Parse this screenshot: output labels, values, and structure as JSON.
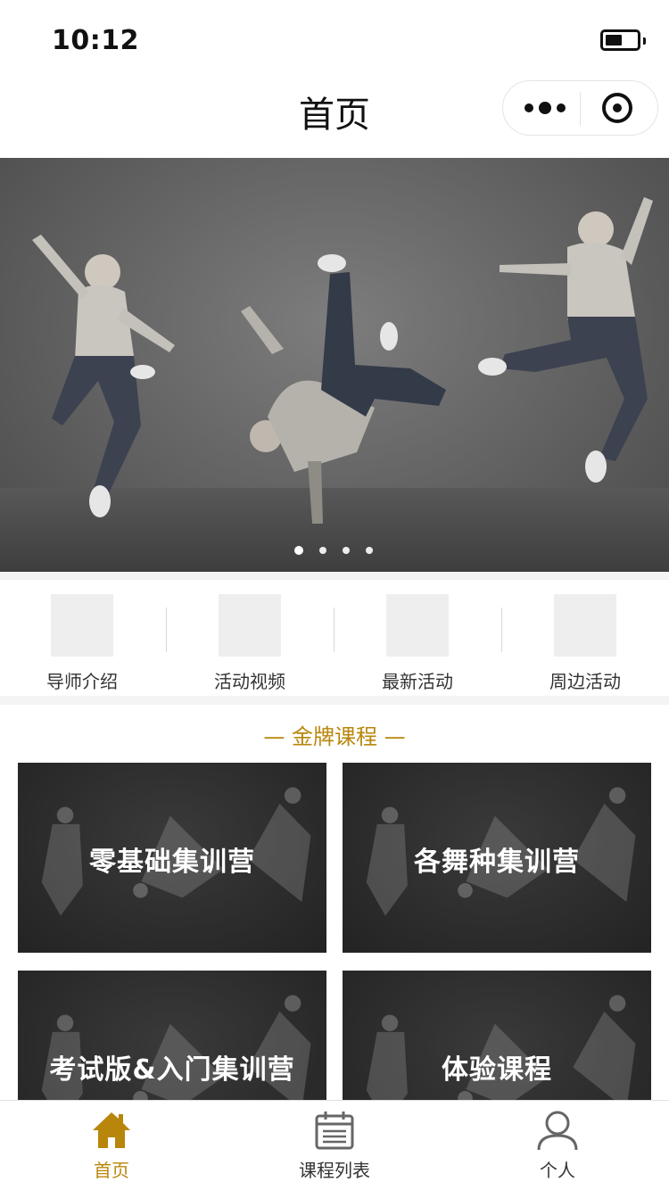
{
  "status_bar": {
    "time": "10:12",
    "battery_level": 0.45
  },
  "nav": {
    "title": "首页",
    "more_icon": "more-dots-icon",
    "close_icon": "target-icon"
  },
  "banner": {
    "slide_count": 4,
    "active_slide": 0
  },
  "quick_menu": {
    "items": [
      {
        "label": "导师介绍"
      },
      {
        "label": "活动视频"
      },
      {
        "label": "最新活动"
      },
      {
        "label": "周边活动"
      }
    ]
  },
  "section": {
    "title": "— 金牌课程 —"
  },
  "courses": [
    {
      "label": "零基础集训营"
    },
    {
      "label": "各舞种集训营"
    },
    {
      "label": "考试版&入门集训营"
    },
    {
      "label": "体验课程"
    }
  ],
  "tab_bar": {
    "tabs": [
      {
        "label": "首页",
        "icon": "home-icon",
        "active": true
      },
      {
        "label": "课程列表",
        "icon": "calendar-icon",
        "active": false
      },
      {
        "label": "个人",
        "icon": "person-icon",
        "active": false
      }
    ],
    "active_color": "#b8860b",
    "inactive_color": "#666666"
  }
}
